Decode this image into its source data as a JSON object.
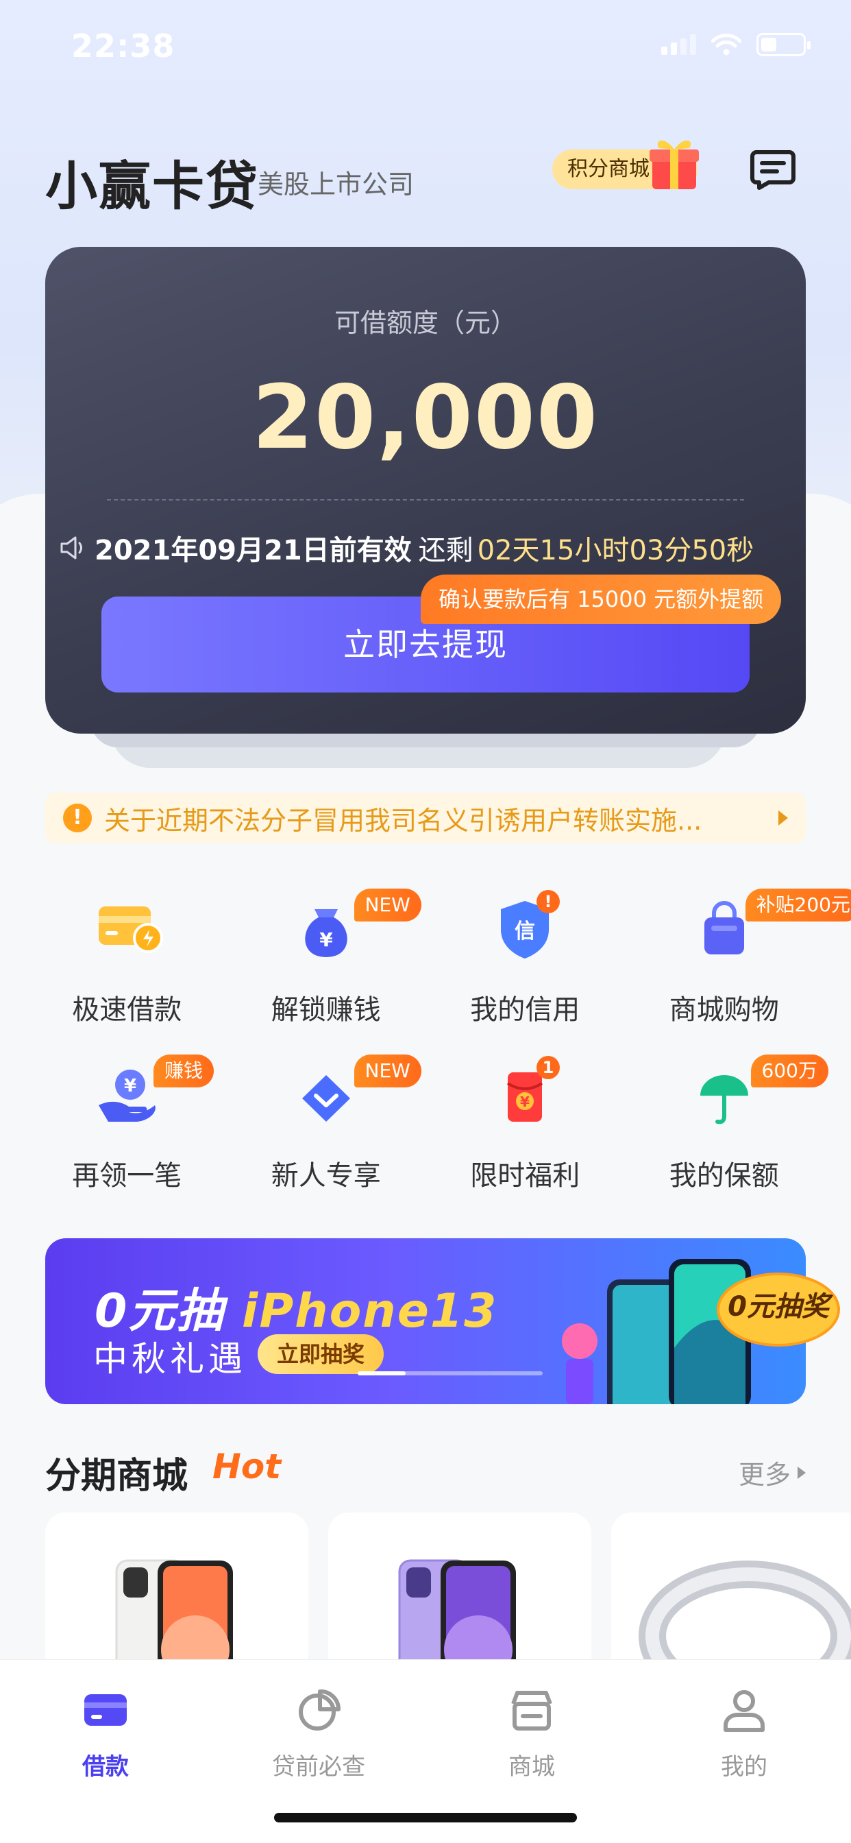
{
  "status_bar": {
    "time": "22:38"
  },
  "header": {
    "title": "小赢卡贷",
    "subtitle": "美股上市公司",
    "points_mall": "积分商城"
  },
  "credit_card": {
    "label": "可借额度（元）",
    "amount": "20,000",
    "expiry_date": "2021年09月21日前有效",
    "remaining_label": "还剩",
    "countdown": "02天15小时03分50秒",
    "bonus_tip": "确认要款后有 15000 元额外提额",
    "withdraw_button": "立即去提现"
  },
  "notice": {
    "icon_text": "!",
    "text": "关于近期不法分子冒用我司名义引诱用户转账实施..."
  },
  "services": [
    {
      "label": "极速借款",
      "icon": "fast-loan-card-icon",
      "badge": ""
    },
    {
      "label": "解锁赚钱",
      "icon": "money-bag-icon",
      "badge": "NEW"
    },
    {
      "label": "我的信用",
      "icon": "credit-shield-icon",
      "badge": "!"
    },
    {
      "label": "商城购物",
      "icon": "shopping-bag-icon",
      "badge": "补贴200元"
    },
    {
      "label": "再领一笔",
      "icon": "hand-coin-icon",
      "badge": "赚钱"
    },
    {
      "label": "新人专享",
      "icon": "diamond-icon",
      "badge": "NEW"
    },
    {
      "label": "限时福利",
      "icon": "red-packet-icon",
      "badge": "1"
    },
    {
      "label": "我的保额",
      "icon": "umbrella-icon",
      "badge": "600万"
    }
  ],
  "banner": {
    "title_prefix": "0元抽",
    "title_highlight": "iPhone13",
    "subtitle": "中秋礼遇",
    "cta": "立即抽奖",
    "badge": "0元抽奖"
  },
  "mall": {
    "title": "分期商城",
    "hot": "Hot",
    "more": "更多"
  },
  "tabbar": {
    "items": [
      {
        "label": "借款",
        "icon": "loan-card-icon",
        "active": true
      },
      {
        "label": "贷前必查",
        "icon": "pie-chart-icon",
        "active": false
      },
      {
        "label": "商城",
        "icon": "store-icon",
        "active": false
      },
      {
        "label": "我的",
        "icon": "profile-icon",
        "active": false
      }
    ]
  },
  "colors": {
    "accent": "#5549f5",
    "amount": "#ffefc0",
    "warning": "#ff9f1a",
    "badge": "#ff7a1a"
  }
}
